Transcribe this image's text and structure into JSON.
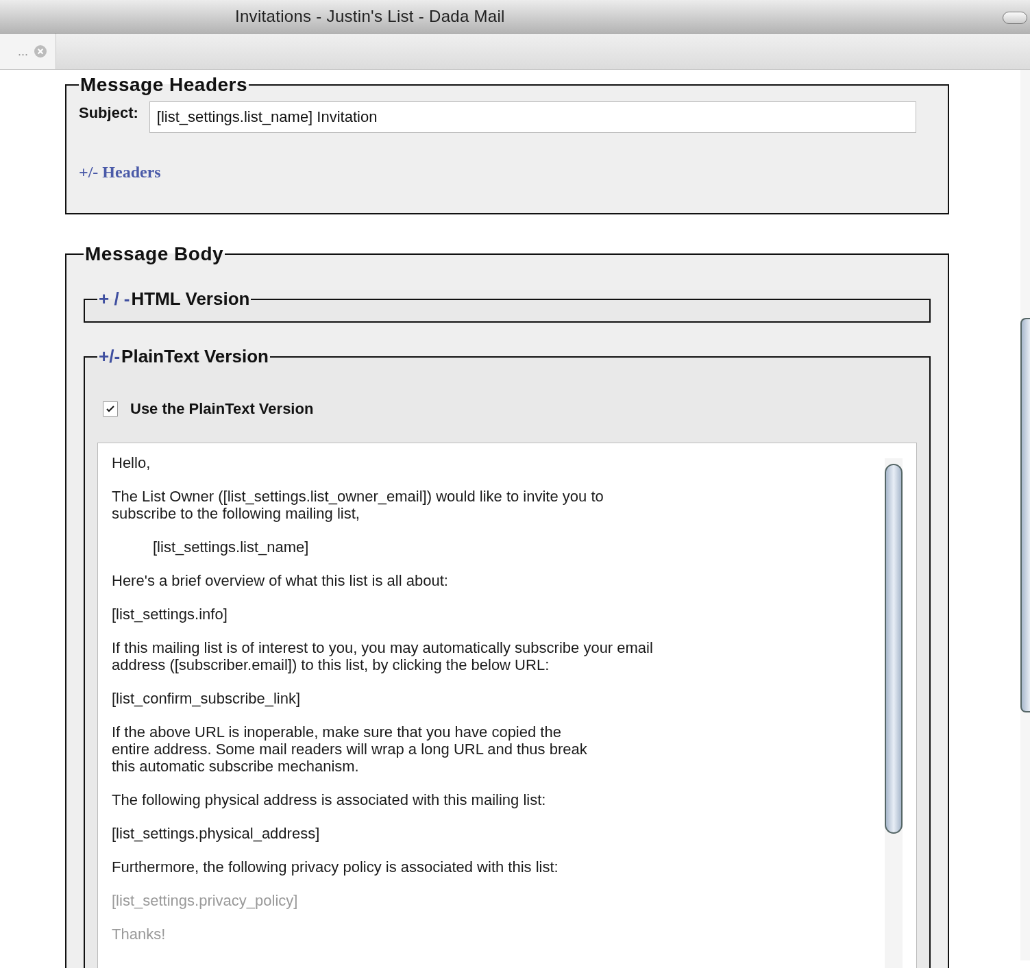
{
  "window": {
    "title": "Invitations - Justin's List - Dada Mail"
  },
  "tab": {
    "label": "..."
  },
  "headers_section": {
    "title": "Message Headers",
    "subject_label": "Subject:",
    "subject_value": "[list_settings.list_name] Invitation",
    "toggle": "+/- Headers"
  },
  "body_section": {
    "title": "Message Body",
    "html_version": {
      "toggle": "+ / -",
      "title": "HTML Version",
      "expanded": false
    },
    "plaintext_version": {
      "toggle": "+/-",
      "title": "PlainText Version",
      "expanded": true,
      "use_checkbox": {
        "label": "Use the PlainText Version",
        "checked": true
      },
      "paragraphs": [
        {
          "kind": "normal",
          "text": "Hello,"
        },
        {
          "kind": "normal",
          "text": "The List Owner ([list_settings.list_owner_email]) would like to invite you to\nsubscribe to the following mailing list,"
        },
        {
          "kind": "indented",
          "text": "[list_settings.list_name]"
        },
        {
          "kind": "normal",
          "text": "Here's a brief overview of what this list is all about:"
        },
        {
          "kind": "normal",
          "text": "[list_settings.info]"
        },
        {
          "kind": "normal",
          "text": "If this mailing list is of interest to you, you may automatically subscribe your email\naddress ([subscriber.email]) to this list, by clicking the below URL:"
        },
        {
          "kind": "normal",
          "text": "[list_confirm_subscribe_link]"
        },
        {
          "kind": "normal",
          "text": "If the above URL is inoperable, make sure that you have copied the\nentire address. Some mail readers will wrap a long URL and thus break\nthis automatic subscribe mechanism."
        },
        {
          "kind": "normal",
          "text": "The following physical address is associated with this mailing list:"
        },
        {
          "kind": "normal",
          "text": "[list_settings.physical_address]"
        },
        {
          "kind": "normal",
          "text": "Furthermore, the following privacy policy is associated with this list:"
        },
        {
          "kind": "faded",
          "text": "[list_settings.privacy_policy]"
        },
        {
          "kind": "faded",
          "text": "Thanks!"
        }
      ]
    }
  }
}
